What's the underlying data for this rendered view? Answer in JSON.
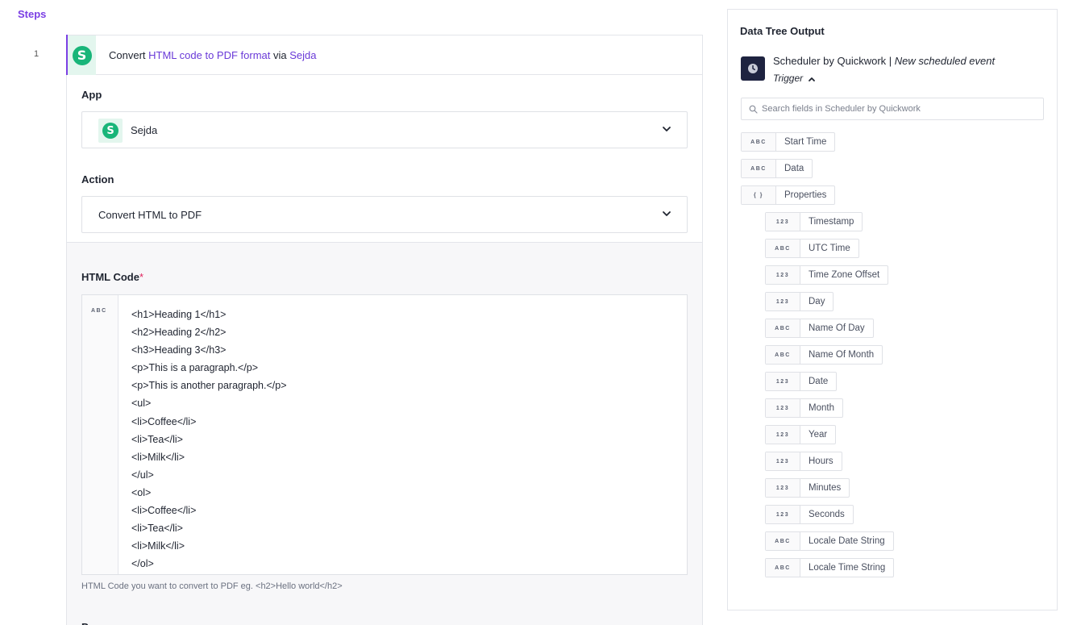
{
  "steps_title": "Steps",
  "step": {
    "number": "1",
    "title_prefix": "Convert ",
    "title_action": "HTML code to PDF format",
    "title_via": " via ",
    "title_app": "Sejda",
    "app_logo_letter": "S"
  },
  "app_field": {
    "label": "App",
    "value": "Sejda",
    "logo_letter": "S"
  },
  "action_field": {
    "label": "Action",
    "value": "Convert HTML to PDF"
  },
  "html_field": {
    "label": "HTML Code",
    "required_mark": "*",
    "type_tag": "ABC",
    "lines": [
      "<h1>Heading 1</h1>",
      "<h2>Heading 2</h2>",
      "<h3>Heading 3</h3>",
      "<p>This is a paragraph.</p>",
      "<p>This is another paragraph.</p>",
      "<ul>",
      "<li>Coffee</li>",
      "<li>Tea</li>",
      "<li>Milk</li>",
      "</ul>",
      "<ol>",
      "<li>Coffee</li>",
      "<li>Tea</li>",
      "<li>Milk</li>",
      "</ol>"
    ],
    "help": "HTML Code you want to convert to PDF eg. <h2>Hello world</h2>"
  },
  "next_field_label": "Pa",
  "tree": {
    "title": "Data Tree Output",
    "trigger_app": "Scheduler by Quickwork",
    "trigger_separator": " | ",
    "trigger_event": "New scheduled event",
    "trigger_type": "Trigger",
    "search_placeholder": "Search fields in Scheduler by Quickwork",
    "items": [
      {
        "tag": "ABC",
        "name": "Start Time",
        "level": 0
      },
      {
        "tag": "ABC",
        "name": "Data",
        "level": 0
      },
      {
        "tag": "{ }",
        "name": "Properties",
        "level": 0
      },
      {
        "tag": "123",
        "name": "Timestamp",
        "level": 1
      },
      {
        "tag": "ABC",
        "name": "UTC Time",
        "level": 1
      },
      {
        "tag": "123",
        "name": "Time Zone Offset",
        "level": 1
      },
      {
        "tag": "123",
        "name": "Day",
        "level": 1
      },
      {
        "tag": "ABC",
        "name": "Name Of Day",
        "level": 1
      },
      {
        "tag": "ABC",
        "name": "Name Of Month",
        "level": 1
      },
      {
        "tag": "123",
        "name": "Date",
        "level": 1
      },
      {
        "tag": "123",
        "name": "Month",
        "level": 1
      },
      {
        "tag": "123",
        "name": "Year",
        "level": 1
      },
      {
        "tag": "123",
        "name": "Hours",
        "level": 1
      },
      {
        "tag": "123",
        "name": "Minutes",
        "level": 1
      },
      {
        "tag": "123",
        "name": "Seconds",
        "level": 1
      },
      {
        "tag": "ABC",
        "name": "Locale Date String",
        "level": 1
      },
      {
        "tag": "ABC",
        "name": "Locale Time String",
        "level": 1
      }
    ]
  },
  "colors": {
    "accent": "#7b3fe4",
    "link": "#6a3ad8",
    "sejda_green": "#18b579",
    "scheduler_dark": "#1e2340"
  }
}
